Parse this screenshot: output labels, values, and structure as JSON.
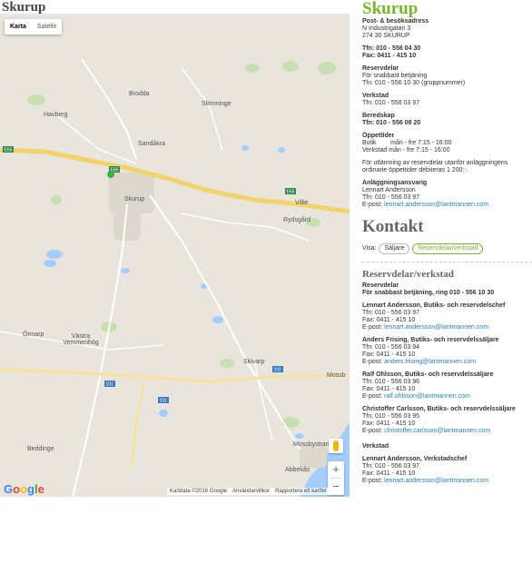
{
  "page": {
    "left_title": "Skurup",
    "right_title": "Skurup"
  },
  "map": {
    "type_buttons": [
      "Karta",
      "Satellit"
    ],
    "places": [
      "Brodda",
      "Havberg",
      "Slimminge",
      "Sandåkra",
      "Skurup",
      "Villie",
      "Rydsgård",
      "Önnarp",
      "Västra Vemmenhög",
      "Skivarp",
      "Mossbystrand",
      "Beddinge",
      "Abbekås",
      "Mossb"
    ],
    "road_labels": [
      "E65",
      "E65",
      "E65",
      "101",
      "101",
      "101"
    ],
    "zoom_in": "+",
    "zoom_out": "−",
    "logo": "Google",
    "attribution": [
      "Kartdata ©2016 Google",
      "Användarvillkor",
      "Rapportera ett kartfel"
    ]
  },
  "info": {
    "address_title": "Post- & besöksadress",
    "address_lines": [
      "N Industrigatan 3",
      "274 30 SKURUP"
    ],
    "phone": "Tfn: 010 - 556 04 30",
    "fax": "Fax: 0411 - 415 10",
    "reservdelar_title": "Reservdelar",
    "reservdelar_lines": [
      "För snabbast betjäning",
      "Tfn: 010 - 556 10 30 (gruppnummer)"
    ],
    "verkstad_title": "Verkstad",
    "verkstad_phone": "Tfn: 010 - 556 03 97",
    "beredskap_title": "Beredskap",
    "beredskap_phone": "Tfn: 010 - 556 08 20",
    "oppettider_title": "Öppettider",
    "oppettider_lines": [
      "Butik        mån - fre 7:15 - 16:00",
      "Verkstad mån - fre 7:15 - 16:00"
    ],
    "note": "För utlämning av reservdelar utanför anläggningens ordinarie öppettider debiteras 1 200:-.",
    "ansvarig_title": "Anläggningsansvarig",
    "ansvarig_name": "Lennart Andersson",
    "ansvarig_phone": "Tfn: 010 - 556 03 97",
    "ansvarig_email_prefix": "E-post:",
    "ansvarig_email": "lennart.andersson@lantmannen.com"
  },
  "kontakt": {
    "title": "Kontakt",
    "visa_label": "Visa:",
    "filters": [
      "Säljare",
      "Reservdelar/verkstad"
    ],
    "section_title": "Reservdelar/verkstad",
    "res_title": "Reservdelar",
    "res_line": "För snabbast betjäning, ring 010 - 556 10 30",
    "contacts": [
      {
        "name": "Lennart Andersson, Butiks- och reservdelschef",
        "phone": "Tfn: 010 - 556 03 97",
        "fax": "Fax: 0411 - 415 10",
        "email": "lennart.andersson@lantmannen.com"
      },
      {
        "name": "Anders Frising, Butiks- och reservdelssäljare",
        "phone": "Tfn: 010 - 556 03 94",
        "fax": "Fax: 0411 - 415 10",
        "email": "anders.frising@lantmannen.com"
      },
      {
        "name": "Ralf Ohlsson, Butiks- och reservdelssäljare",
        "phone": "Tfn: 010 - 556 03 96",
        "fax": "Fax: 0411 - 415 10",
        "email": "ralf.ohlsson@lantmannen.com"
      },
      {
        "name": "Christoffer Carlsson, Butiks- och reservdelssäljare",
        "phone": "Tfn: 010 - 556 03 95",
        "fax": "Fax: 0411 - 415 10",
        "email": "christoffer.carlsson@lantmannen.com"
      }
    ],
    "verkstad_title": "Verkstad",
    "verkstad_contact": {
      "name": "Lennart Andersson, Verkstadschef",
      "phone": "Tfn: 010 - 556 03 97",
      "fax": "Fax: 0411 - 415 10",
      "email": "lennart.andersson@lantmannen.com"
    },
    "email_prefix": "E-post:"
  }
}
